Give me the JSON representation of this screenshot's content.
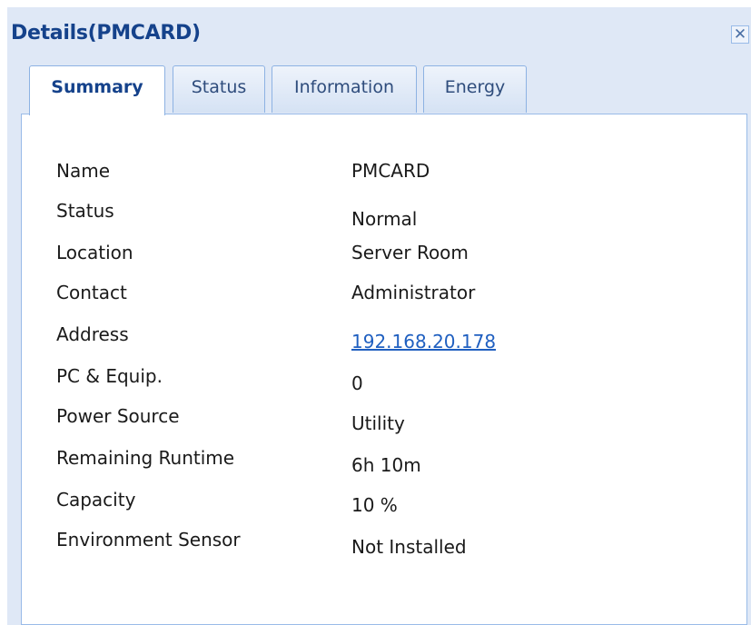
{
  "window": {
    "title": "Details(PMCARD)",
    "close_label": "✕"
  },
  "tabs": [
    {
      "label": "Summary",
      "active": true
    },
    {
      "label": "Status",
      "active": false
    },
    {
      "label": "Information",
      "active": false
    },
    {
      "label": "Energy",
      "active": false
    }
  ],
  "summary": {
    "rows": [
      {
        "label": "Name",
        "value": "PMCARD"
      },
      {
        "label": "Status",
        "value": "Normal"
      },
      {
        "label": "Location",
        "value": "Server Room"
      },
      {
        "label": "Contact",
        "value": "Administrator"
      },
      {
        "label": "Address",
        "value": "192.168.20.178"
      },
      {
        "label": "PC & Equip.",
        "value": "0"
      },
      {
        "label": "Power Source",
        "value": "Utility"
      },
      {
        "label": "Remaining Runtime",
        "value": "6h 10m"
      },
      {
        "label": "Capacity",
        "value": "10 %"
      },
      {
        "label": "Environment Sensor",
        "value": "Not Installed"
      }
    ]
  },
  "colors": {
    "window_bg": "#dfe8f6",
    "title": "#15428b",
    "tab_border": "#8db2e3",
    "link": "#1f5fc0"
  }
}
